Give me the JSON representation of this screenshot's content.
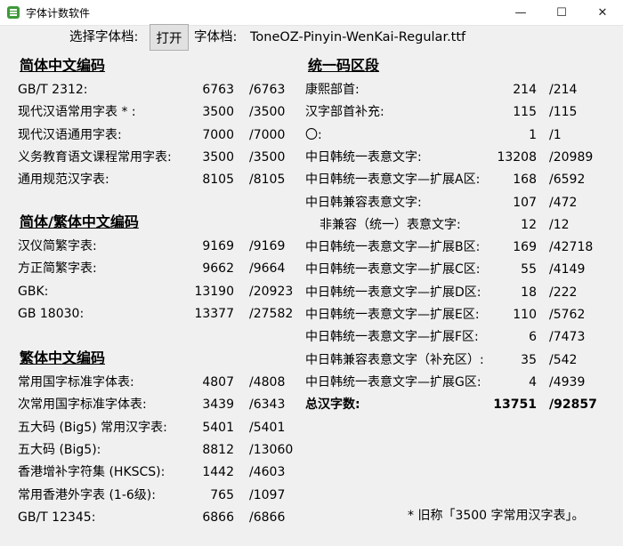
{
  "window": {
    "title": "字体计数软件",
    "min_glyph": "—",
    "max_glyph": "☐",
    "close_glyph": "✕"
  },
  "toolbar": {
    "select_label": "选择字体档:",
    "open_button": "打开",
    "font_file_label": "字体档:",
    "font_file_name": "ToneOZ-Pinyin-WenKai-Regular.ttf"
  },
  "left": {
    "sections": [
      {
        "title": "简体中文编码",
        "rows": [
          {
            "label": "GB/T 2312:",
            "count": "6763",
            "total": "/6763"
          },
          {
            "label": "现代汉语常用字表 * :",
            "count": "3500",
            "total": "/3500"
          },
          {
            "label": "现代汉语通用字表:",
            "count": "7000",
            "total": "/7000"
          },
          {
            "label": "义务教育语文课程常用字表:",
            "count": "3500",
            "total": "/3500"
          },
          {
            "label": "通用规范汉字表:",
            "count": "8105",
            "total": "/8105"
          }
        ]
      },
      {
        "title": "简体/繁体中文编码",
        "rows": [
          {
            "label": "汉仪简繁字表:",
            "count": "9169",
            "total": "/9169"
          },
          {
            "label": "方正简繁字表:",
            "count": "9662",
            "total": "/9664"
          },
          {
            "label": "GBK:",
            "count": "13190",
            "total": "/20923"
          },
          {
            "label": "GB 18030:",
            "count": "13377",
            "total": "/27582"
          }
        ]
      },
      {
        "title": "繁体中文编码",
        "rows": [
          {
            "label": "常用国字标准字体表:",
            "count": "4807",
            "total": "/4808"
          },
          {
            "label": "次常用国字标准字体表:",
            "count": "3439",
            "total": "/6343"
          },
          {
            "label": "五大码 (Big5) 常用汉字表:",
            "count": "5401",
            "total": "/5401"
          },
          {
            "label": "五大码 (Big5):",
            "count": "8812",
            "total": "/13060"
          },
          {
            "label": "香港增补字符集 (HKSCS):",
            "count": "1442",
            "total": "/4603"
          },
          {
            "label": "常用香港外字表 (1-6级):",
            "count": "765",
            "total": "/1097"
          },
          {
            "label": "GB/T 12345:",
            "count": "6866",
            "total": "/6866"
          }
        ]
      }
    ]
  },
  "right": {
    "title": "统一码区段",
    "rows": [
      {
        "label": "康熙部首:",
        "count": "214",
        "total": "/214"
      },
      {
        "label": "汉字部首补充:",
        "count": "115",
        "total": "/115"
      },
      {
        "label": "〇:",
        "count": "1",
        "total": "/1"
      },
      {
        "label": "中日韩统一表意文字:",
        "count": "13208",
        "total": "/20989"
      },
      {
        "label": "中日韩统一表意文字—扩展A区:",
        "count": "168",
        "total": "/6592"
      },
      {
        "label": "中日韩兼容表意文字:",
        "count": "107",
        "total": "/472"
      },
      {
        "label": "非兼容（统一）表意文字:",
        "count": "12",
        "total": "/12"
      },
      {
        "label": "中日韩统一表意文字—扩展B区:",
        "count": "169",
        "total": "/42718"
      },
      {
        "label": "中日韩统一表意文字—扩展C区:",
        "count": "55",
        "total": "/4149"
      },
      {
        "label": "中日韩统一表意文字—扩展D区:",
        "count": "18",
        "total": "/222"
      },
      {
        "label": "中日韩统一表意文字—扩展E区:",
        "count": "110",
        "total": "/5762"
      },
      {
        "label": "中日韩统一表意文字—扩展F区:",
        "count": "6",
        "total": "/7473"
      },
      {
        "label": "中日韩兼容表意文字（补充区）:",
        "count": "35",
        "total": "/542"
      },
      {
        "label": "中日韩统一表意文字—扩展G区:",
        "count": "4",
        "total": "/4939"
      }
    ],
    "total": {
      "label": "总汉字数:",
      "count": "13751",
      "total": "/92857"
    }
  },
  "footnote": "* 旧称「3500 字常用汉字表」。"
}
